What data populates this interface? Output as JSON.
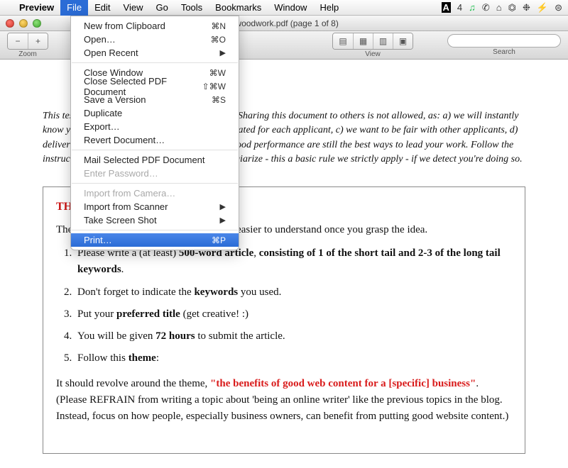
{
  "menubar": {
    "app": "Preview",
    "items": [
      "File",
      "Edit",
      "View",
      "Go",
      "Tools",
      "Bookmarks",
      "Window",
      "Help"
    ],
    "right": [
      "4",
      "♫",
      "✆",
      "⌂",
      "⏣",
      "❉",
      "⚡",
      "⊜"
    ]
  },
  "window": {
    "title": "woodwork.pdf (page 1 of 8)"
  },
  "toolbar": {
    "zoom": "Zoom",
    "view": "View",
    "search_label": "Search",
    "search_placeholder": ""
  },
  "dropdown": {
    "groups": [
      [
        {
          "label": "New from Clipboard",
          "short": "⌘N"
        },
        {
          "label": "Open…",
          "short": "⌘O"
        },
        {
          "label": "Open Recent",
          "sub": true
        }
      ],
      [
        {
          "label": "Close Window",
          "short": "⌘W"
        },
        {
          "label": "Close Selected PDF Document",
          "short": "⇧⌘W"
        },
        {
          "label": "Save a Version",
          "short": "⌘S"
        },
        {
          "label": "Duplicate"
        },
        {
          "label": "Export…"
        },
        {
          "label": "Revert Document…"
        }
      ],
      [
        {
          "label": "Mail Selected PDF Document"
        },
        {
          "label": "Enter Password…",
          "disabled": true
        }
      ],
      [
        {
          "label": "Import from Camera…",
          "disabled": true
        },
        {
          "label": "Import from Scanner",
          "sub": true
        },
        {
          "label": "Take Screen Shot",
          "sub": true
        }
      ],
      [
        {
          "label": "Print…",
          "short": "⌘P",
          "selected": true
        }
      ]
    ]
  },
  "doc": {
    "intro": "This test is intended for Content applicants only. Sharing this document to others is not allowed, as: a) we will instantly know you're doing so, b) tests given are differentiated for each applicant, c) we want to be fair with other applicants, d) delivering high quality output and maintaining good performance are still the best ways to lead your work. Follow the instructions as indicated for this test. Do not plagiarize - this a basic rule we strictly apply - if we detect you're doing so.",
    "heading": "THE TEST",
    "lead": "The instruction's pretty long but it's really easier to understand once you grasp the idea.",
    "li1a": "Please write a (at least) ",
    "li1b": "500-word article",
    "li1c": ", ",
    "li1d": "consisting of 1 of the short tail and 2-3 of the long tail keywords",
    "li1e": ".",
    "li2a": "Don't forget to indicate the ",
    "li2b": "keywords",
    "li2c": " you used.",
    "li3a": "Put your ",
    "li3b": "preferred title",
    "li3c": " (get creative! :)",
    "li4a": "You will be given ",
    "li4b": "72 hours",
    "li4c": " to submit the article.",
    "li5a": "Follow this ",
    "li5b": "theme",
    "li5c": ":",
    "tail1": "It should revolve around the theme, ",
    "quoted": "\"the benefits of good web content for a [specific] business\"",
    "tail2": ". (Please REFRAIN from writing a topic about 'being an online writer' like the previous topics in the blog. Instead, focus on how people, especially business owners, can benefit from putting good website content.)"
  }
}
